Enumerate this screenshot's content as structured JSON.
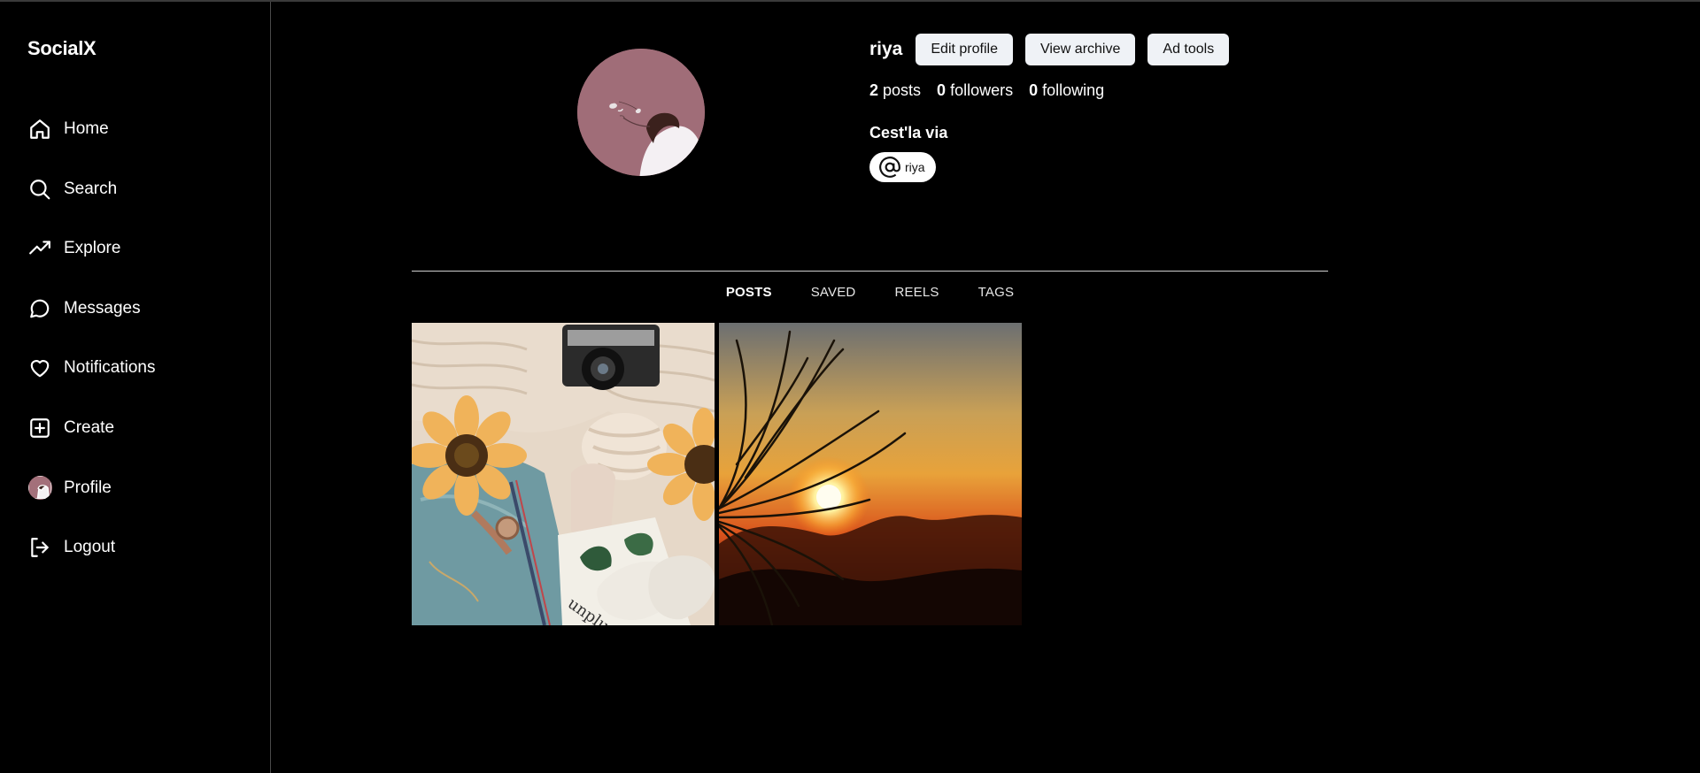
{
  "app": {
    "brand": "SocialX"
  },
  "sidebar": {
    "items": [
      {
        "label": "Home",
        "icon": "home-icon"
      },
      {
        "label": "Search",
        "icon": "search-icon"
      },
      {
        "label": "Explore",
        "icon": "trending-icon"
      },
      {
        "label": "Messages",
        "icon": "message-icon"
      },
      {
        "label": "Notifications",
        "icon": "heart-icon"
      },
      {
        "label": "Create",
        "icon": "plus-square-icon"
      },
      {
        "label": "Profile",
        "icon": "avatar"
      },
      {
        "label": "Logout",
        "icon": "logout-icon"
      }
    ]
  },
  "profile": {
    "username": "riya",
    "buttons": {
      "edit": "Edit profile",
      "archive": "View archive",
      "ads": "Ad tools"
    },
    "stats": {
      "posts_count": "2",
      "posts_label": "posts",
      "followers_count": "0",
      "followers_label": "followers",
      "following_count": "0",
      "following_label": "following"
    },
    "bio": "Cest'la via",
    "handle": "riya"
  },
  "tabs": [
    {
      "label": "POSTS",
      "active": true
    },
    {
      "label": "SAVED",
      "active": false
    },
    {
      "label": "REELS",
      "active": false
    },
    {
      "label": "TAGS",
      "active": false
    }
  ],
  "posts": [
    {
      "subject": "sunflowers-camera-flatlay"
    },
    {
      "subject": "sunset-palm"
    }
  ]
}
